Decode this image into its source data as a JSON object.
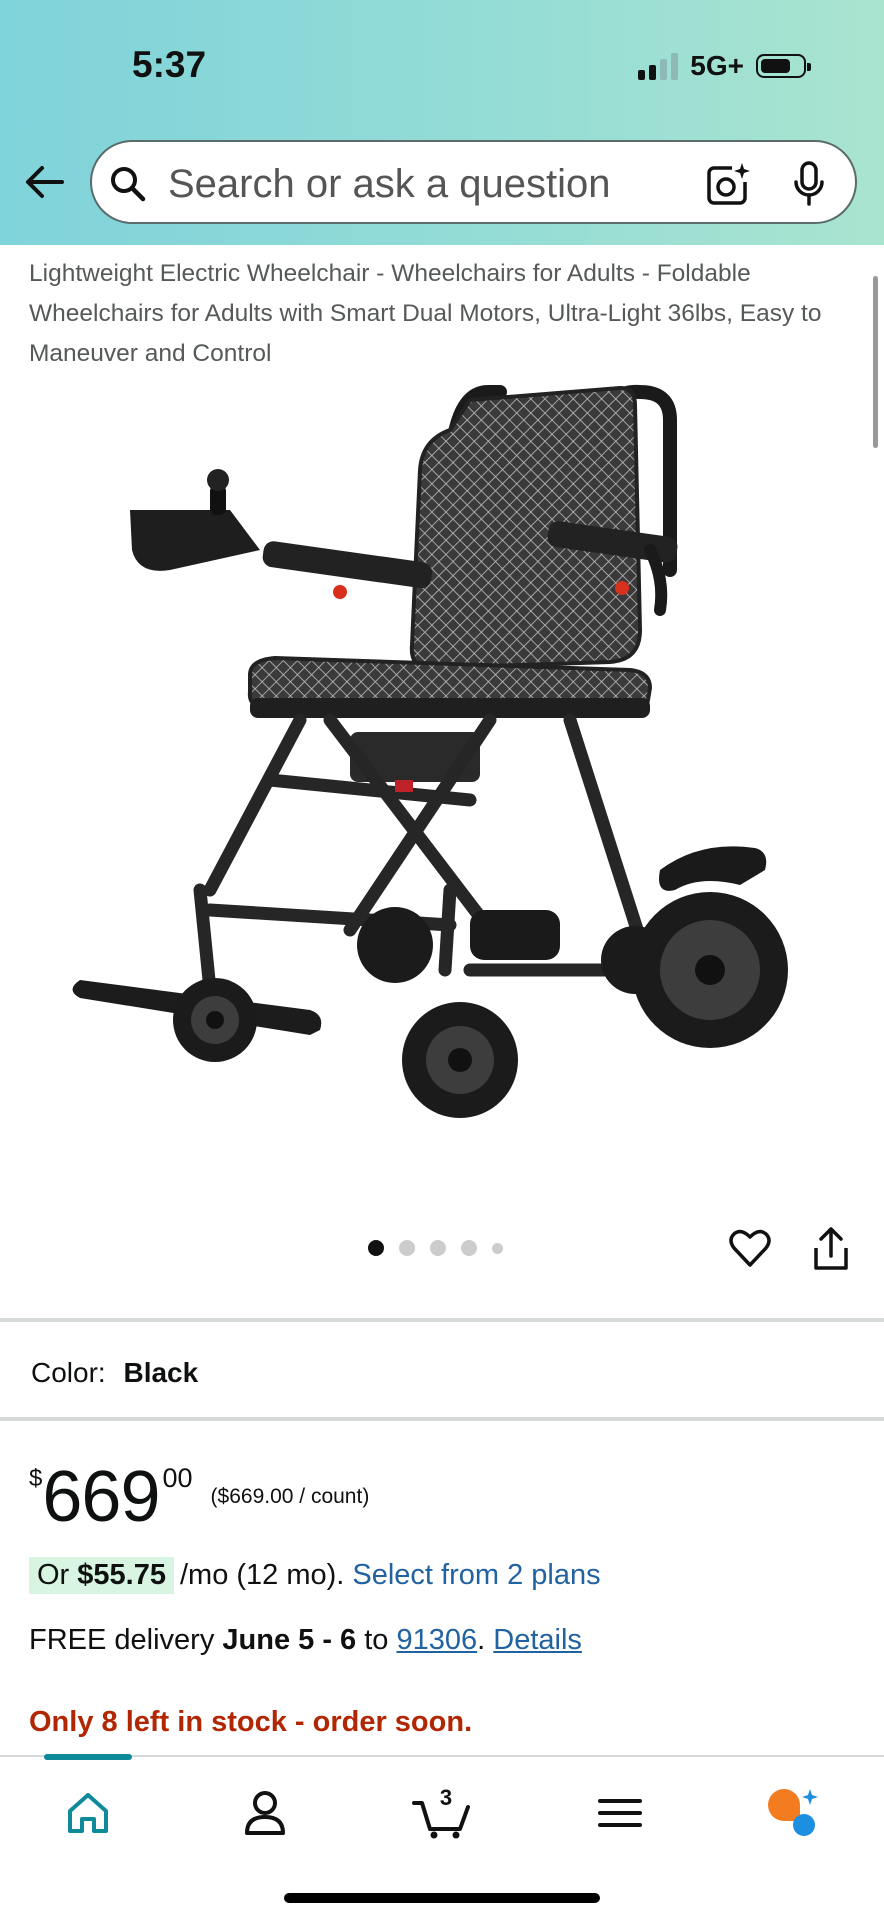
{
  "status": {
    "time": "5:37",
    "network": "5G+"
  },
  "search": {
    "placeholder": "Search or ask a question"
  },
  "product": {
    "title": "Lightweight Electric Wheelchair - Wheelchairs for Adults - Foldable Wheelchairs for Adults with Smart Dual Motors, Ultra-Light 36lbs, Easy to Maneuver and Control",
    "image_count": 5,
    "active_image": 1
  },
  "color": {
    "label": "Color:",
    "value": "Black"
  },
  "price": {
    "currency": "$",
    "whole": "669",
    "fraction": "00",
    "unit_price": "($669.00 / count)"
  },
  "monthly": {
    "prefix": "Or",
    "amount": "$55.75",
    "suffix": "/mo (12 mo).",
    "link": "Select from 2 plans"
  },
  "delivery": {
    "prefix": "FREE delivery",
    "dates": "June 5 - 6",
    "to": "to",
    "zip": "91306",
    "dot": ".",
    "details": "Details"
  },
  "stock": "Only 8 left in stock - order soon.",
  "nav": {
    "cart_count": "3",
    "active": "home"
  },
  "colors": {
    "accent": "#0e8a9a",
    "link": "#2162a1",
    "stock": "#b12704",
    "header_start": "#7fd3da",
    "header_end": "#a9e4cf"
  }
}
